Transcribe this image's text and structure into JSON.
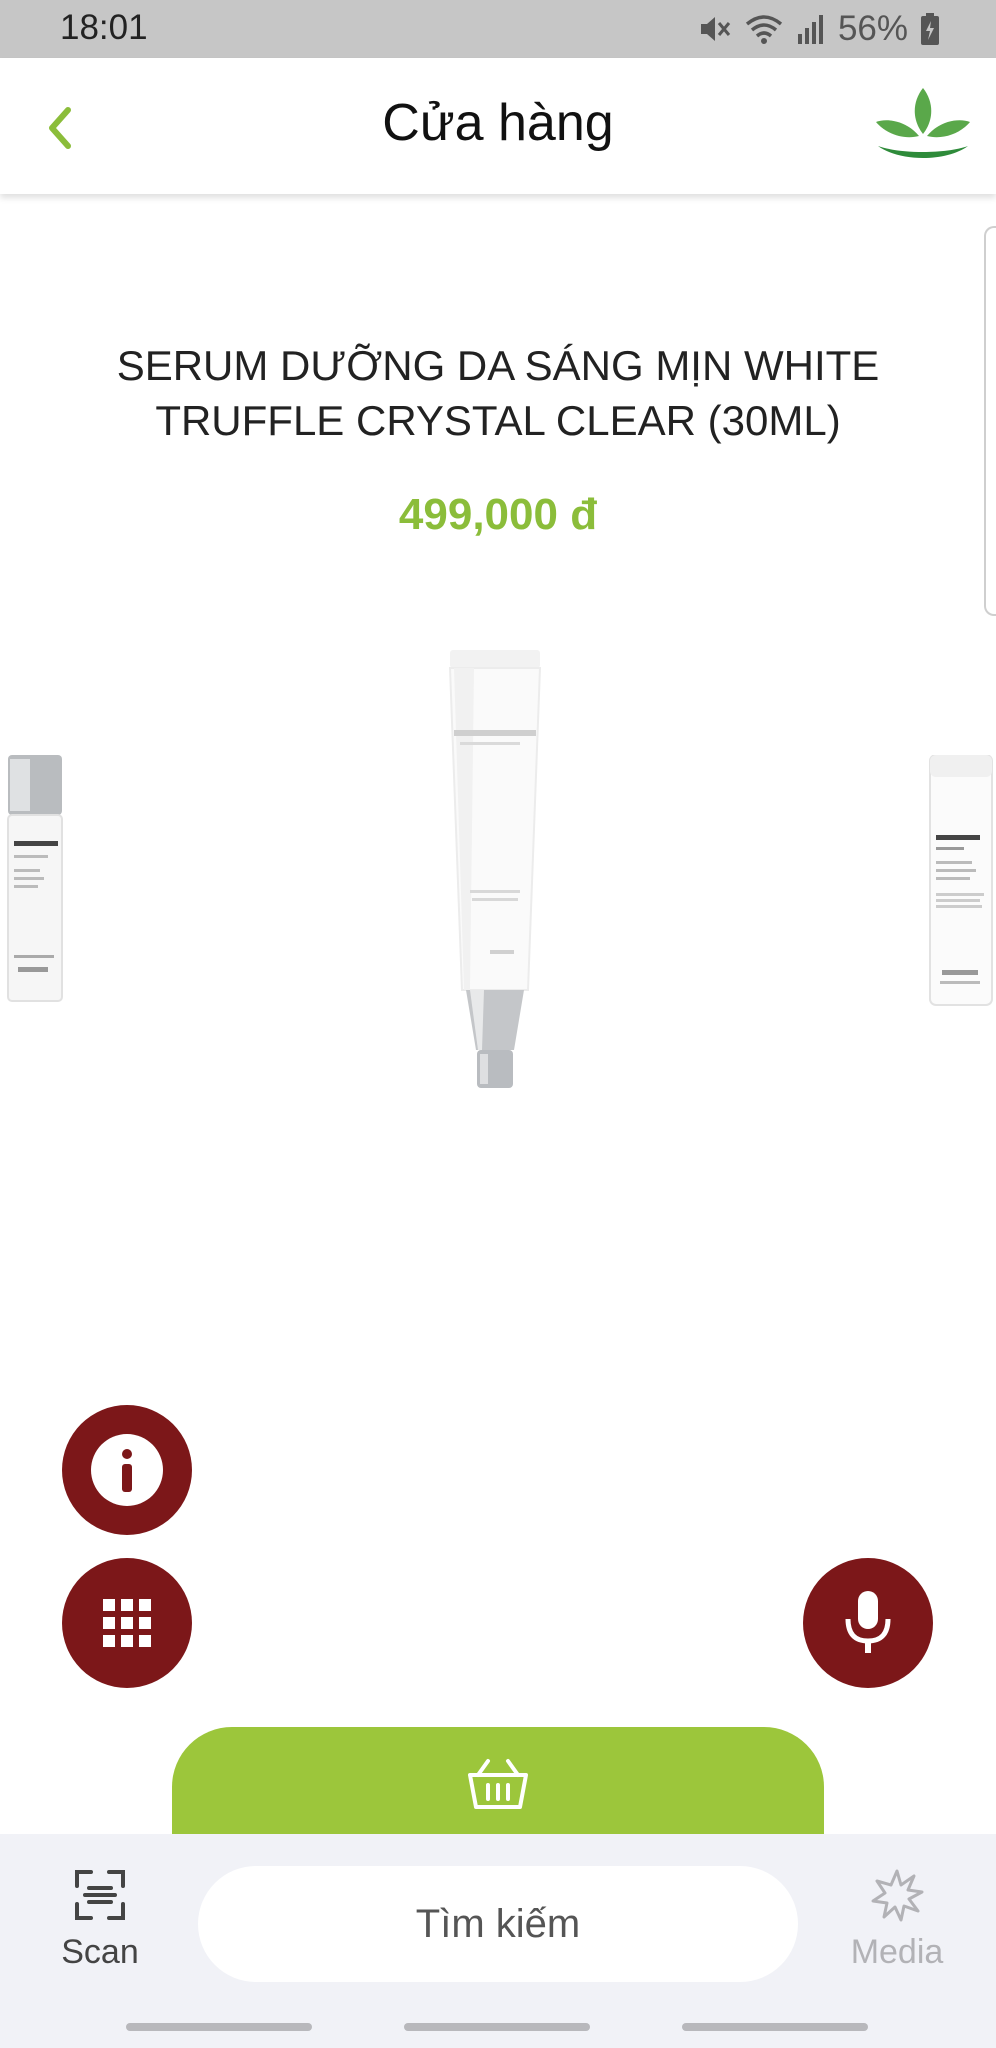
{
  "status_bar": {
    "time": "18:01",
    "battery": "56%",
    "icons": [
      "mute-icon",
      "wifi-icon",
      "signal-icon",
      "battery-charging-icon"
    ]
  },
  "header": {
    "title": "Cửa hàng",
    "back_icon": "chevron-left-icon",
    "logo_icon": "lotus-leaf-logo"
  },
  "product": {
    "title": "SERUM DƯỠNG DA SÁNG MỊN WHITE TRUFFLE CRYSTAL CLEAR (30ML)",
    "price": "499,000 đ",
    "main_image": "white-truffle-serum-tube",
    "prev_image": "white-truffle-bottle",
    "next_image": "white-truffle-toner-bottle"
  },
  "actions": {
    "info_icon": "info-icon",
    "grid_icon": "grid-icon",
    "mic_icon": "microphone-icon",
    "cart_icon": "basket-icon"
  },
  "bottom_bar": {
    "scan_label": "Scan",
    "search_placeholder": "Tìm kiếm",
    "media_label": "Media"
  },
  "colors": {
    "accent_green": "#9cc63b",
    "price_green": "#8bbd3a",
    "fab_red": "#7c1719",
    "status_bar_gray": "#c6c6c6",
    "bottom_bar_bg": "#f1f2f7"
  }
}
